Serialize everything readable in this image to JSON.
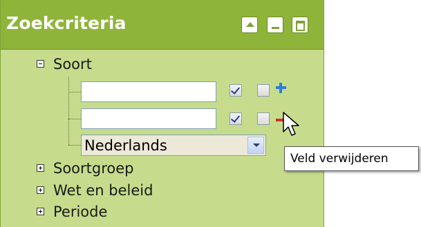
{
  "panel": {
    "title": "Zoekcriteria",
    "header_buttons": [
      {
        "name": "collapse-up-icon"
      },
      {
        "name": "minimize-icon"
      },
      {
        "name": "maximize-icon"
      }
    ],
    "colors": {
      "header_bg": "#8fb43a",
      "panel_bg": "#c6dc8c",
      "add": "#2e7be0",
      "remove": "#d03030"
    }
  },
  "tree": {
    "soort": {
      "label": "Soort",
      "expanded": true,
      "rows": [
        {
          "input_value": "",
          "checkbox1": true,
          "checkbox2": false,
          "action": "add-icon"
        },
        {
          "input_value": "",
          "checkbox1": true,
          "checkbox2": false,
          "action": "remove-icon"
        }
      ],
      "language_select": {
        "selected": "Nederlands"
      }
    },
    "soortgroep": {
      "label": "Soortgroep",
      "expanded": false
    },
    "wet_beleid": {
      "label": "Wet en beleid",
      "expanded": false
    },
    "periode": {
      "label": "Periode",
      "expanded": false
    }
  },
  "tooltip": {
    "text": "Veld verwijderen"
  }
}
